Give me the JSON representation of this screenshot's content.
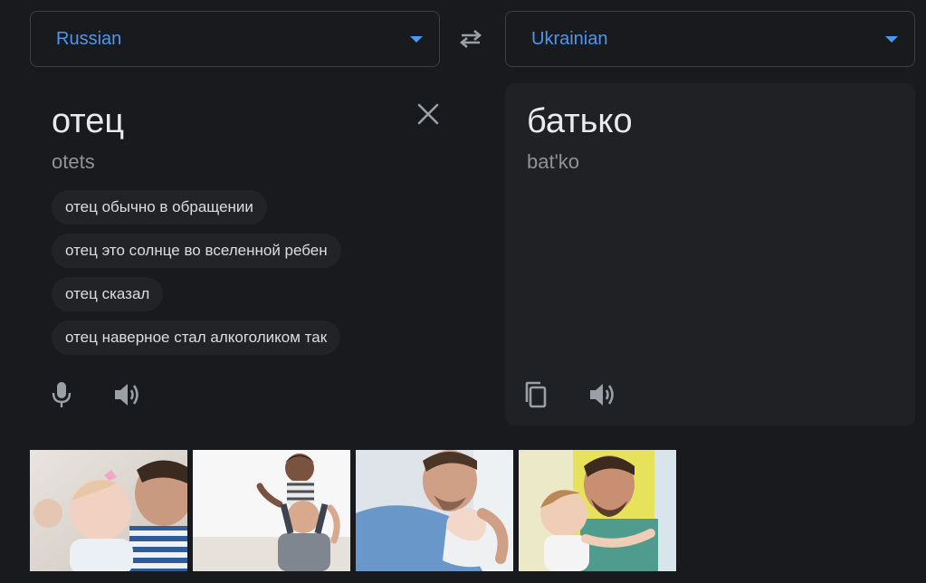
{
  "source_lang": {
    "label": "Russian"
  },
  "target_lang": {
    "label": "Ukrainian"
  },
  "source": {
    "text": "отец",
    "transliteration": "otets",
    "suggestions": [
      "отец обычно в обращении",
      "отец это солнце во вселенной ребен",
      "отец сказал",
      "отец наверное стал алкоголиком так"
    ]
  },
  "target": {
    "text": "батько",
    "transliteration": "bat'ko"
  },
  "icons": {
    "swap": "swap-icon",
    "clear": "close-icon",
    "mic": "microphone-icon",
    "speaker": "speaker-icon",
    "copy": "copy-icon"
  },
  "colors": {
    "accent": "#4d97ef",
    "background": "#181a1d",
    "panel": "#1f2124",
    "chip": "#212327",
    "icon": "#9aa0a6"
  }
}
